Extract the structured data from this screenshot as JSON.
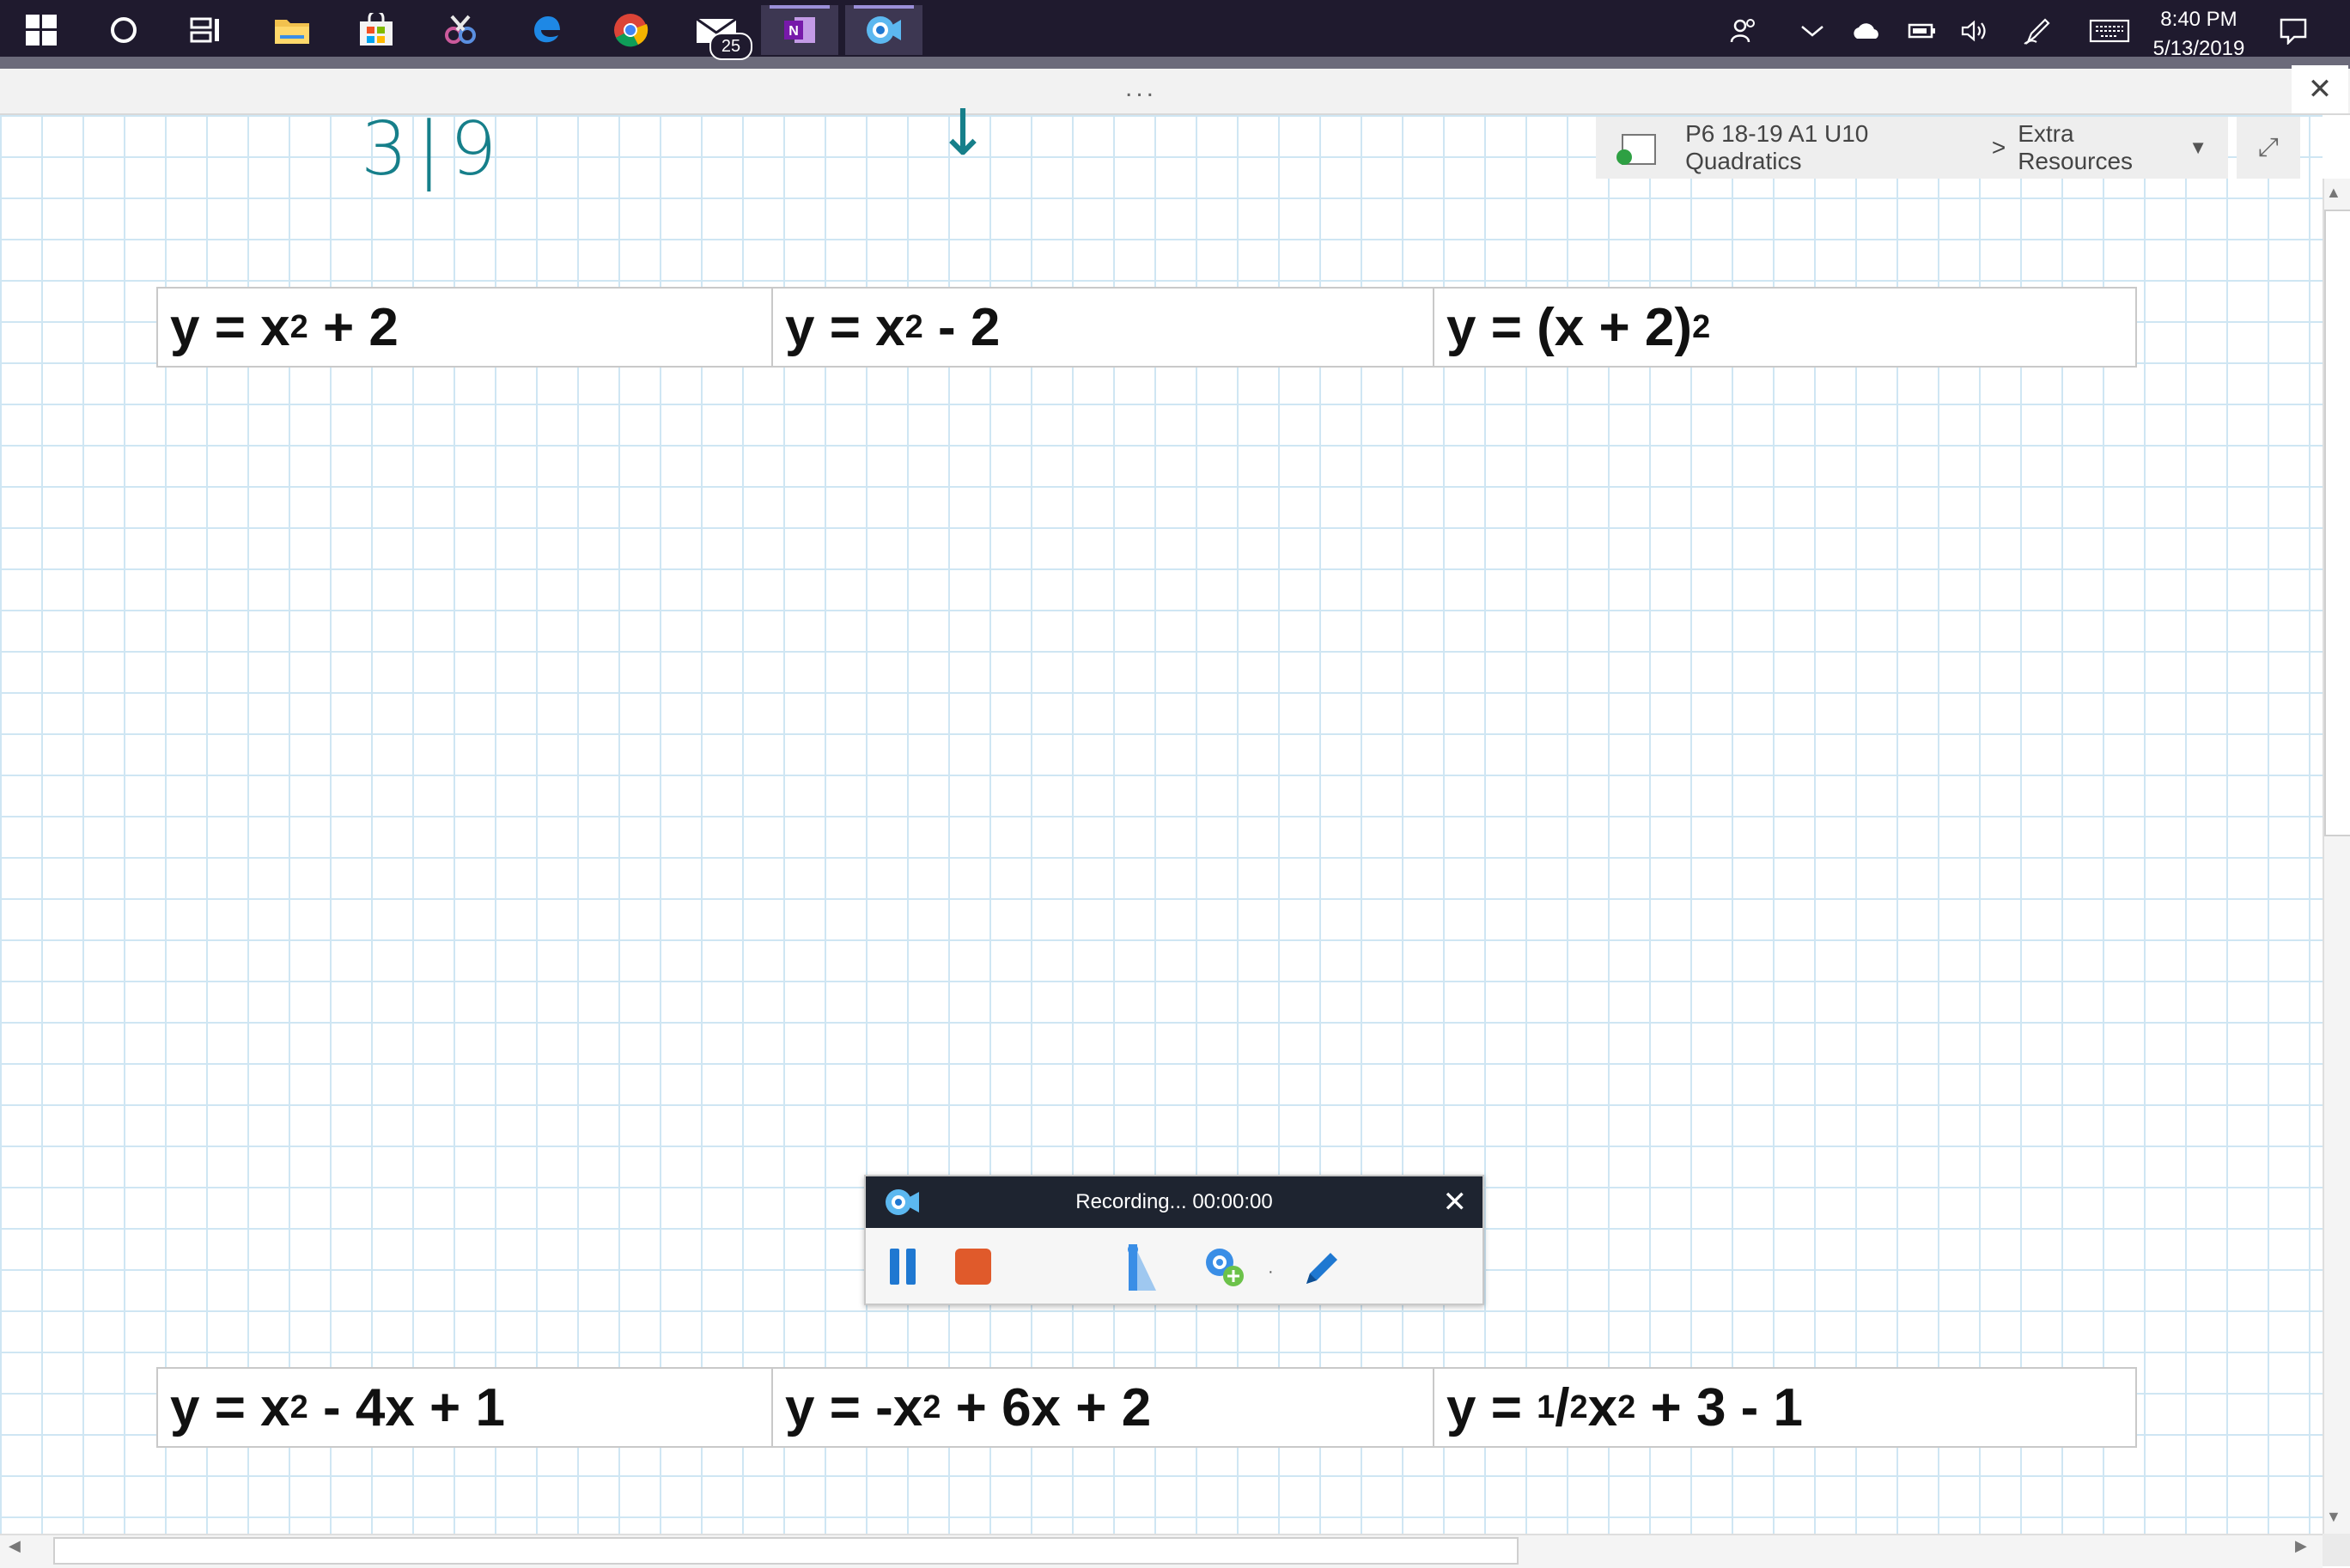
{
  "taskbar": {
    "apps": [
      {
        "icon": "windows-start-icon"
      },
      {
        "icon": "cortana-search-icon"
      },
      {
        "icon": "task-view-icon"
      },
      {
        "icon": "file-explorer-icon"
      },
      {
        "icon": "microsoft-store-icon"
      },
      {
        "icon": "snipping-tool-icon"
      },
      {
        "icon": "edge-browser-icon"
      },
      {
        "icon": "chrome-browser-icon"
      },
      {
        "icon": "mail-icon",
        "badge": "25"
      },
      {
        "icon": "onenote-icon"
      },
      {
        "icon": "screencast-recorder-icon"
      }
    ],
    "tray": [
      "people-icon",
      "chevron-up-icon",
      "onedrive-cloud-icon",
      "battery-icon",
      "volume-icon",
      "pen-ink-icon",
      "touch-keyboard-icon",
      "action-center-icon"
    ],
    "time": "8:40 PM",
    "date": "5/13/2019",
    "bg_color": "#1f1a2e"
  },
  "onenote": {
    "dots": "...",
    "close": "✕",
    "breadcrumb": {
      "notebook": "P6 18-19 A1 U10 Quadratics",
      "separator": ">",
      "section": "Extra Resources"
    },
    "expand": "⤢"
  },
  "canvas": {
    "handwriting_top": "3|9",
    "handwriting_arrow": "↓",
    "ink_color": "#167f8a",
    "grid_color": "#cfe6f3"
  },
  "equations_top": [
    {
      "base": "y = x",
      "sup": "2",
      "tail": " + 2"
    },
    {
      "base": "y = x",
      "sup": "2",
      "tail": " - 2"
    },
    {
      "base": "y = (x + 2)",
      "sup": "2",
      "tail": ""
    }
  ],
  "equations_bottom": [
    {
      "base": "y = x",
      "sup": "2",
      "tail": " - 4x + 1"
    },
    {
      "base": "y = -x",
      "sup": "2",
      "tail": " + 6x + 2"
    },
    {
      "pre": "y = ",
      "num": "1",
      "slash": "/",
      "den": "2",
      "var": "x",
      "sup": "2",
      "tail": " + 3 - 1"
    }
  ],
  "recorder": {
    "status": "Recording... 00:00:00",
    "close": "✕",
    "accent_pause": "#1f78d1",
    "accent_stop": "#e05a2b"
  }
}
